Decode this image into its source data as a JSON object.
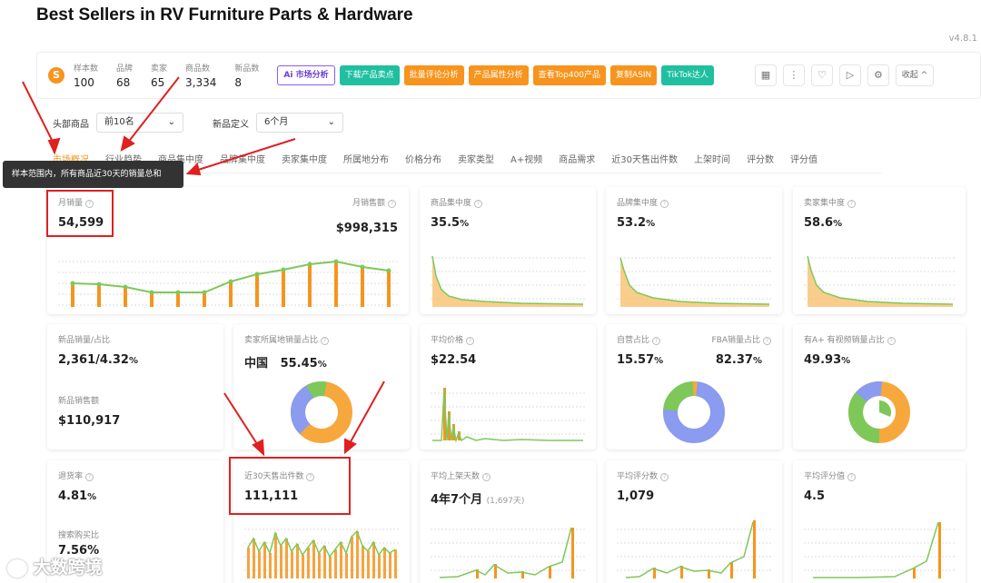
{
  "page": {
    "title": "Best Sellers in RV Furniture Parts & Hardware",
    "version": "v4.8.1"
  },
  "toolbar": {
    "logo": "S",
    "stats": [
      {
        "label": "样本数",
        "value": "100"
      },
      {
        "label": "品牌",
        "value": "68"
      },
      {
        "label": "卖家",
        "value": "65"
      },
      {
        "label": "商品数",
        "value": "3,334"
      },
      {
        "label": "新品数",
        "value": "8"
      }
    ],
    "buttons": {
      "ai": "Ai 市场分析",
      "download": "下载产品卖点",
      "review": "批量评论分析",
      "attr": "产品属性分析",
      "top400": "查看Top400产品",
      "copy_asin": "复制ASIN",
      "tiktok": "TikTok达人"
    },
    "icons": [
      "grid-icon",
      "more-icon",
      "heart-icon",
      "play-icon",
      "settings-icon"
    ],
    "collapse_label": "收起 ^"
  },
  "filters": {
    "head_label": "头部商品",
    "head_value": "前10名",
    "new_label": "新品定义",
    "new_value": "6个月",
    "chevron": "⌄"
  },
  "tabs": [
    "市场概况",
    "行业趋势",
    "商品集中度",
    "品牌集中度",
    "卖家集中度",
    "所属地分布",
    "价格分布",
    "卖家类型",
    "A+视频",
    "商品需求",
    "近30天售出件数",
    "上架时间",
    "评分数",
    "评分值"
  ],
  "tooltip": "样本范围内，所有商品近30天的销量总和",
  "cards": {
    "monthly": {
      "sales_label": "月销量",
      "sales_value": "54,599",
      "revenue_label": "月销售额",
      "revenue_value": "$998,315"
    },
    "product_conc": {
      "label": "商品集中度",
      "value": "35.5",
      "unit": "%"
    },
    "brand_conc": {
      "label": "品牌集中度",
      "value": "53.2",
      "unit": "%"
    },
    "seller_conc": {
      "label": "卖家集中度",
      "value": "58.6",
      "unit": "%"
    },
    "new_sales": {
      "label": "新品销量/占比",
      "value": "2,361/4.32",
      "unit": "%",
      "rev_label": "新品销售额",
      "rev_value": "$110,917"
    },
    "seller_loc": {
      "label": "卖家所属地销量占比",
      "country": "中国",
      "value": "55.45",
      "unit": "%"
    },
    "avg_price": {
      "label": "平均价格",
      "value": "$22.54"
    },
    "self_fba": {
      "self_label": "自营占比",
      "self_value": "15.57",
      "fba_label": "FBA销量占比",
      "fba_value": "82.37",
      "unit": "%"
    },
    "aplus": {
      "label": "有A+ 有视频销量占比",
      "value": "49.93",
      "unit": "%"
    },
    "return": {
      "label": "退货率",
      "value": "4.81",
      "unit": "%",
      "search_label": "搜索购买比",
      "search_value": "7.56%"
    },
    "sold30": {
      "label": "近30天售出件数",
      "value": "111,111"
    },
    "avg_days": {
      "label": "平均上架天数",
      "value": "4年7个月",
      "sub": "(1,697天)"
    },
    "avg_rating_count": {
      "label": "平均评分数",
      "value": "1,079"
    },
    "avg_rating": {
      "label": "平均评分值",
      "value": "4.5"
    }
  },
  "colors": {
    "accent": "#f7941d",
    "teal": "#1fbfa0",
    "green": "#7ec85a",
    "purple": "#8a9bf0",
    "red": "#e02020"
  },
  "watermark": "大数跨境"
}
